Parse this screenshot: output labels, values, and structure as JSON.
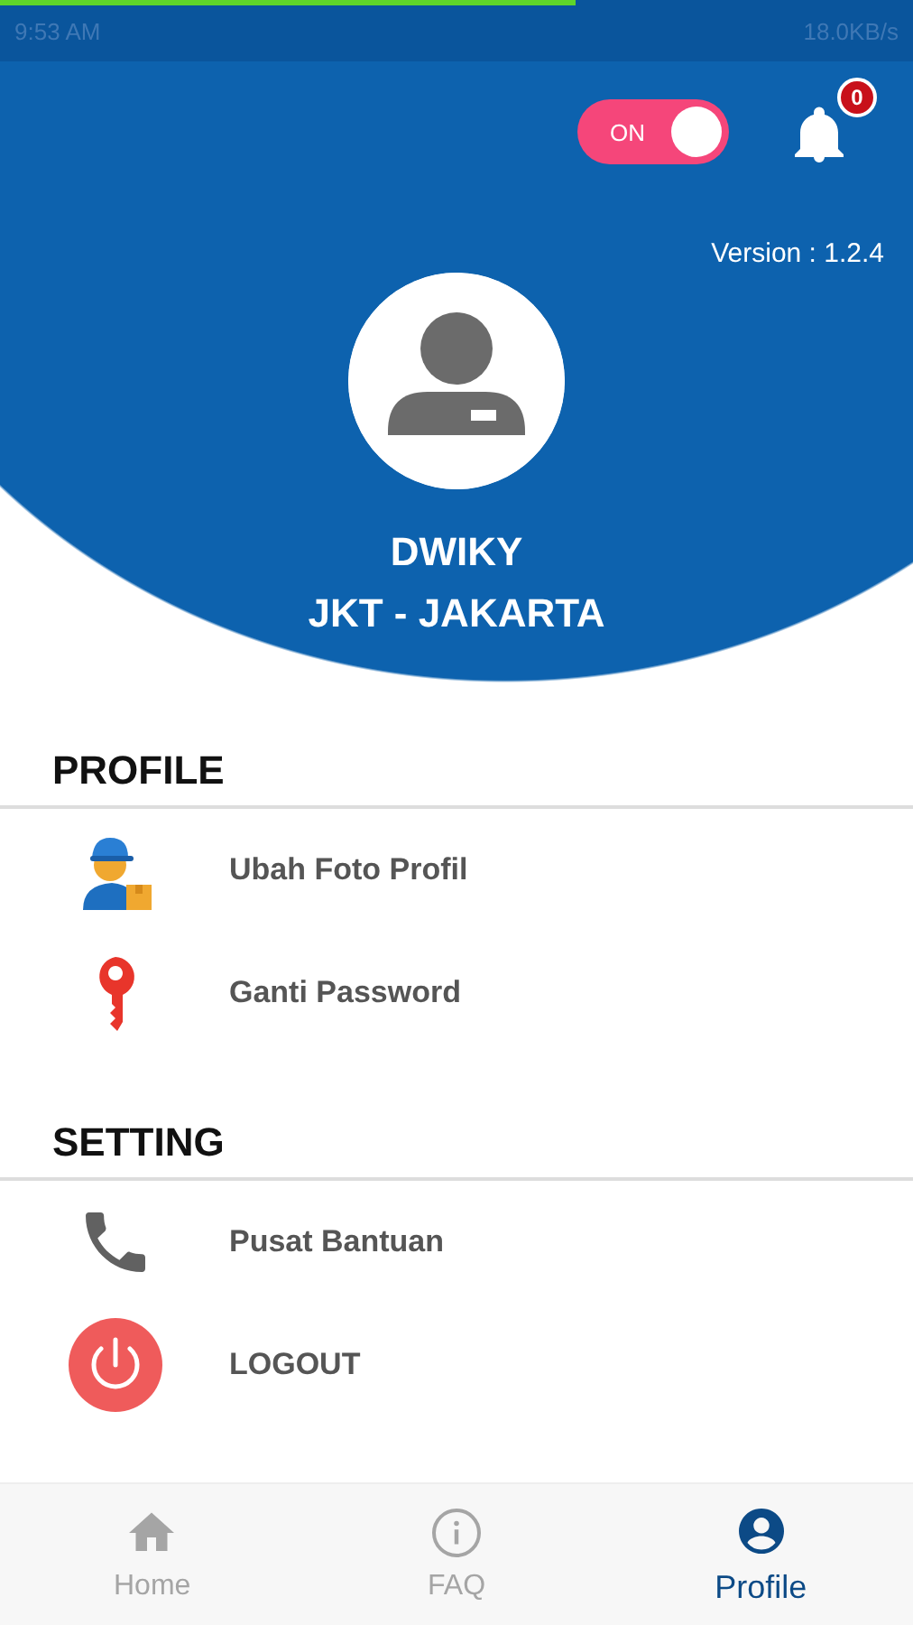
{
  "status_bar": {
    "time": "9:53 AM",
    "speed": "18.0KB/s",
    "loading": {
      "level": 0.63
    }
  },
  "header": {
    "toggle": {
      "label": "ON",
      "on": true
    },
    "notifications": {
      "count": "0"
    }
  },
  "profile": {
    "version": "Version : 1.2.4",
    "name": "DWIKY",
    "location": "JKT - JAKARTA"
  },
  "sections": [
    {
      "title": "PROFILE",
      "items": [
        {
          "label": "Ubah Foto Profil",
          "kind": "courier"
        },
        {
          "label": "Ganti Password",
          "kind": "key"
        }
      ]
    },
    {
      "title": "SETTING",
      "items": [
        {
          "label": "Pusat Bantuan",
          "kind": "phone"
        },
        {
          "label": "LOGOUT",
          "kind": "power"
        }
      ]
    }
  ],
  "bottom_nav": [
    {
      "label": "Home",
      "kind": "home",
      "selected": false
    },
    {
      "label": "FAQ",
      "kind": "info",
      "selected": false
    },
    {
      "label": "Profile",
      "kind": "person",
      "selected": true
    }
  ]
}
